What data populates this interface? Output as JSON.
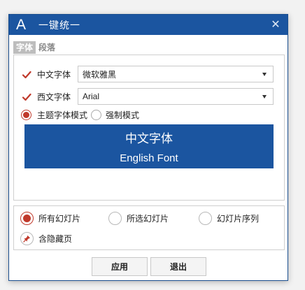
{
  "window": {
    "title": "一键统一",
    "app_icon_glyph": "A",
    "close_glyph": "✕",
    "accent_color": "#1b55a0"
  },
  "tabs": [
    {
      "label": "字体",
      "active": true
    },
    {
      "label": "段落",
      "active": false
    }
  ],
  "font": {
    "chinese": {
      "label": "中文字体",
      "checked": true,
      "value": "微软雅黑"
    },
    "western": {
      "label": "西文字体",
      "checked": true,
      "value": "Arial"
    },
    "mode_theme": {
      "label": "主题字体模式",
      "selected": true
    },
    "mode_force": {
      "label": "强制模式",
      "selected": false
    }
  },
  "preview": {
    "chinese_text": "中文字体",
    "english_text": "English Font"
  },
  "scope": {
    "all_slides": {
      "label": "所有幻灯片",
      "selected": true
    },
    "selected_slides": {
      "label": "所选幻灯片",
      "selected": false
    },
    "slide_sequence": {
      "label": "幻灯片序列",
      "selected": false
    },
    "include_hidden": {
      "label": "含隐藏页"
    }
  },
  "buttons": {
    "apply": "应用",
    "exit": "退出"
  },
  "colors": {
    "check_red": "#c0392b"
  }
}
